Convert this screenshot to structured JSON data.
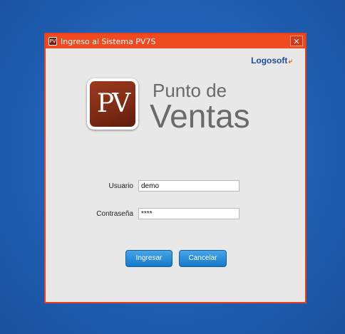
{
  "window": {
    "title": "Ingreso al Sistema PV7S",
    "close_glyph": "✕",
    "title_icon_text": "PV"
  },
  "branding": {
    "vendor": "Logosoft",
    "vendor_mark": "⤶",
    "logo_letters": "PV",
    "product_line1": "Punto de",
    "product_line2": "Ventas"
  },
  "form": {
    "username_label": "Usuario",
    "username_value": "demo",
    "password_label": "Contraseña",
    "password_value": "****"
  },
  "buttons": {
    "login_label": "Ingresar",
    "cancel_label": "Cancelar"
  },
  "colors": {
    "desktop": "#1f5fb3",
    "titlebar": "#f04a20",
    "button": "#1e88d8",
    "logo": "#8a3016"
  },
  "icons": {
    "close": "close-icon",
    "app": "app-icon"
  }
}
